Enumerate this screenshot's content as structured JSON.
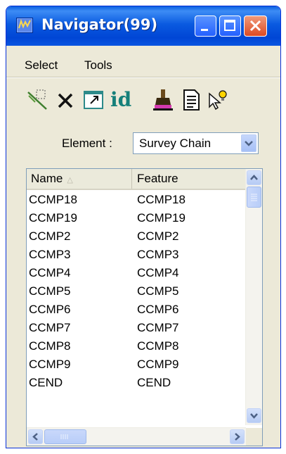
{
  "window": {
    "title": "Navigator(99)",
    "icons": {
      "app": "navigator-app-icon",
      "minimize": "minimize-icon",
      "maximize": "maximize-icon",
      "close": "close-icon"
    }
  },
  "menu": {
    "items": [
      {
        "label": "Select"
      },
      {
        "label": "Tools"
      }
    ]
  },
  "toolbar": {
    "icons": [
      "select-chain-icon",
      "delete-x-icon",
      "fit-view-icon",
      "id-icon",
      "highlight-paint-icon",
      "report-document-icon",
      "query-bulb-icon"
    ],
    "id_label": "id"
  },
  "filter": {
    "label": "Element :",
    "value": "Survey Chain"
  },
  "list": {
    "columns": [
      {
        "label": "Name",
        "sorted": "ascending"
      },
      {
        "label": "Feature"
      }
    ],
    "rows": [
      {
        "name": "CCMP18",
        "feature": "CCMP18"
      },
      {
        "name": "CCMP19",
        "feature": "CCMP19"
      },
      {
        "name": "CCMP2",
        "feature": "CCMP2"
      },
      {
        "name": "CCMP3",
        "feature": "CCMP3"
      },
      {
        "name": "CCMP4",
        "feature": "CCMP4"
      },
      {
        "name": "CCMP5",
        "feature": "CCMP5"
      },
      {
        "name": "CCMP6",
        "feature": "CCMP6"
      },
      {
        "name": "CCMP7",
        "feature": "CCMP7"
      },
      {
        "name": "CCMP8",
        "feature": "CCMP8"
      },
      {
        "name": "CCMP9",
        "feature": "CCMP9"
      },
      {
        "name": "CEND",
        "feature": "CEND"
      }
    ]
  },
  "colors": {
    "titlebar": "#0a55e0",
    "window_bg": "#ece9d8",
    "id_icon": "#16807a",
    "scroll_blue": "#b6cbf4"
  }
}
